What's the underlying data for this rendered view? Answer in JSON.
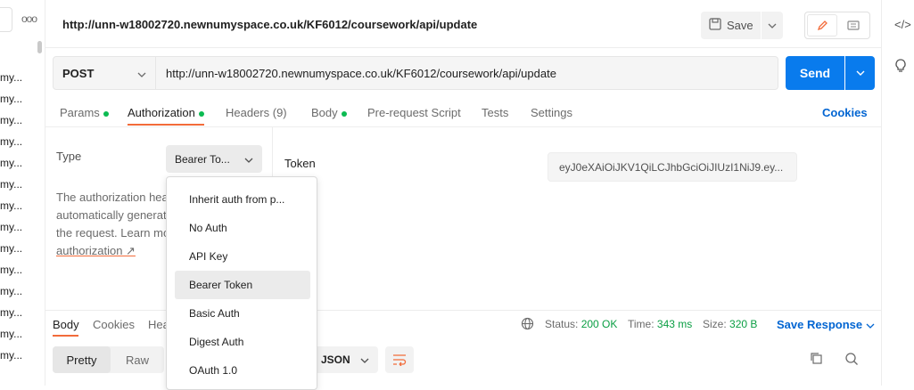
{
  "sidebar": {
    "more_glyph": "ooo",
    "items": [
      "my...",
      "my...",
      "my...",
      "my...",
      "my...",
      "my...",
      "my...",
      "my...",
      "my...",
      "my...",
      "my...",
      "my...",
      "my...",
      "my..."
    ]
  },
  "header": {
    "title": "http://unn-w18002720.newnumyspace.co.uk/KF6012/coursework/api/update",
    "save_label": "Save"
  },
  "request": {
    "method": "POST",
    "url": "http://unn-w18002720.newnumyspace.co.uk/KF6012/coursework/api/update",
    "send_label": "Send"
  },
  "tabs": [
    {
      "label": "Params",
      "dot": true
    },
    {
      "label": "Authorization",
      "dot": true
    },
    {
      "label": "Headers (9)",
      "dot": false
    },
    {
      "label": "Body",
      "dot": true
    },
    {
      "label": "Pre-request Script",
      "dot": false
    },
    {
      "label": "Tests",
      "dot": false
    },
    {
      "label": "Settings",
      "dot": false
    }
  ],
  "cookies_label": "Cookies",
  "auth": {
    "type_label": "Type",
    "selected_type": "Bearer To...",
    "description_lines": [
      "The authorization hea",
      "automatically generat",
      "the request. Learn mo"
    ],
    "link_label": "authorization ↗",
    "token_label": "Token",
    "token_value": "eyJ0eXAiOiJKV1QiLCJhbGciOiJIUzI1NiJ9.ey..."
  },
  "auth_dropdown": {
    "options": [
      "Inherit auth from p...",
      "No Auth",
      "API Key",
      "Bearer Token",
      "Basic Auth",
      "Digest Auth",
      "OAuth 1.0"
    ],
    "selected": "Bearer Token"
  },
  "response": {
    "tabs": [
      "Body",
      "Cookies",
      "Hea"
    ],
    "status_label": "Status:",
    "status_value": "200 OK",
    "time_label": "Time:",
    "time_value": "343 ms",
    "size_label": "Size:",
    "size_value": "320 B",
    "save_response_label": "Save Response",
    "view_modes": [
      "Pretty",
      "Raw"
    ],
    "format": "JSON"
  },
  "colors": {
    "accent": "#f26b3a",
    "primary": "#097bed",
    "success": "#0cbb52",
    "link": "#0265d2"
  }
}
